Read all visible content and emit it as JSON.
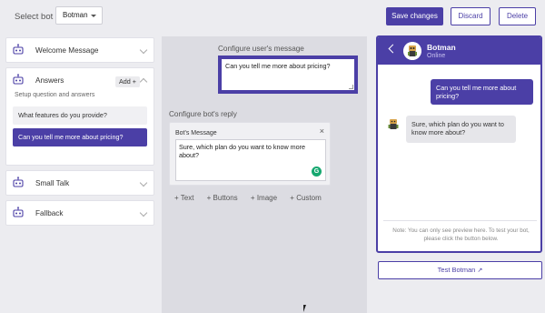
{
  "topbar": {
    "select_label": "Select bot",
    "bot_value": "Botman",
    "save_label": "Save changes",
    "discard_label": "Discard",
    "delete_label": "Delete"
  },
  "sidebar": {
    "welcome": "Welcome Message",
    "answers": "Answers",
    "add_label": "Add +",
    "answers_sub": "Setup question and answers",
    "questions": [
      "What features do you provide?",
      "Can you tell me more about pricing?"
    ],
    "small_talk": "Small Talk",
    "fallback": "Fallback"
  },
  "editor": {
    "user_label": "Configure user's message",
    "user_message": "Can you tell me more about pricing?",
    "bot_label": "Configure bot's reply",
    "bot_box_title": "Bot's Message",
    "bot_message": "Sure, which plan do you want to know more about?",
    "add_text": "+ Text",
    "add_buttons": "+ Buttons",
    "add_image": "+ Image",
    "add_custom": "+ Custom"
  },
  "preview": {
    "bot_name": "Botman",
    "status": "Online",
    "user_bubble": "Can you tell me more about pricing?",
    "bot_bubble": "Sure, which plan do you want to know more about?",
    "note": "Note: You can only see preview here. To test your bot, please click the button below.",
    "test_label": "Test Botman"
  },
  "colors": {
    "accent": "#4b3fa6",
    "background": "#ececf0",
    "editor_bg": "#dcdce2"
  }
}
